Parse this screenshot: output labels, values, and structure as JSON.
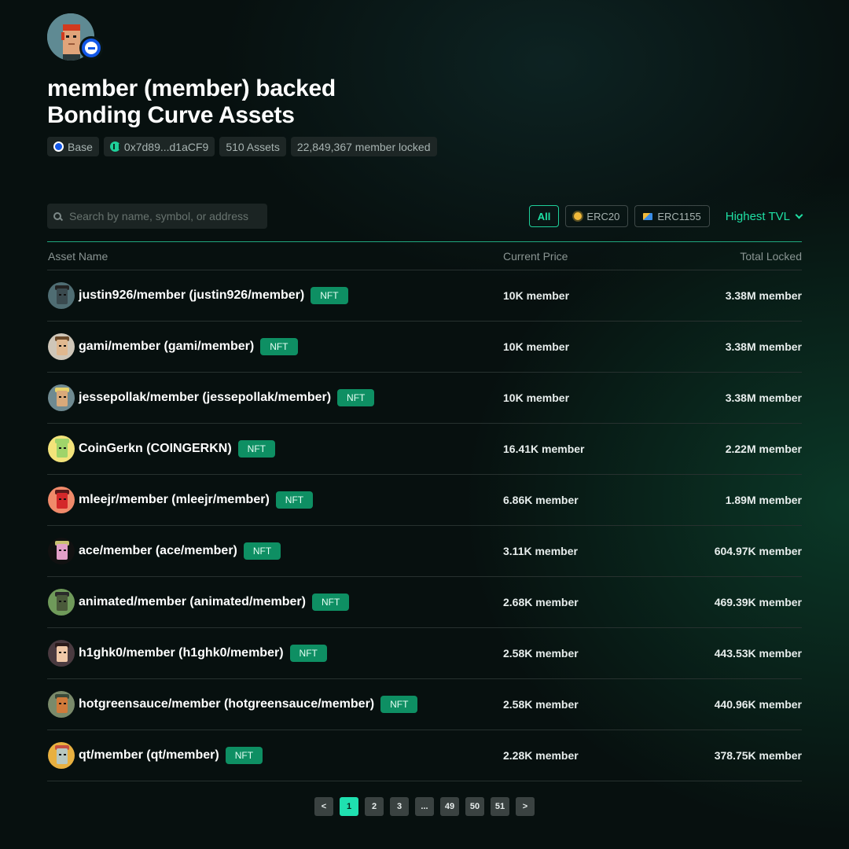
{
  "header": {
    "title_line1": "member (member) backed",
    "title_line2": "Bonding Curve Assets",
    "chain": "Base",
    "address": "0x7d89...d1aCF9",
    "assets_count": "510 Assets",
    "locked": "22,849,367 member locked"
  },
  "search": {
    "placeholder": "Search by name, symbol, or address"
  },
  "filters": {
    "all": "All",
    "erc20": "ERC20",
    "erc1155": "ERC1155",
    "sort": "Highest TVL"
  },
  "table": {
    "headers": {
      "name": "Asset Name",
      "price": "Current Price",
      "locked": "Total Locked"
    },
    "rows": [
      {
        "name": "justin926/member (justin926/member)",
        "badge": "NFT",
        "price": "10K member",
        "locked": "3.38M member",
        "bg": "#4f6d73",
        "skin": "#3a4a4f",
        "hat": "#222"
      },
      {
        "name": "gami/member (gami/member)",
        "badge": "NFT",
        "price": "10K member",
        "locked": "3.38M member",
        "bg": "#cfc6b8",
        "skin": "#e0b88f",
        "hat": "#6b4a2a"
      },
      {
        "name": "jessepollak/member (jessepollak/member)",
        "badge": "NFT",
        "price": "10K member",
        "locked": "3.38M member",
        "bg": "#6f8a91",
        "skin": "#d9a97a",
        "hat": "#e8d36a"
      },
      {
        "name": "CoinGerkn (COINGERKN)",
        "badge": "NFT",
        "price": "16.41K member",
        "locked": "2.22M member",
        "bg": "#f2e37a",
        "skin": "#9fd46a",
        "hat": "#9fd46a"
      },
      {
        "name": "mleejr/member (mleejr/member)",
        "badge": "NFT",
        "price": "6.86K member",
        "locked": "1.89M member",
        "bg": "#f08a6a",
        "skin": "#d4282a",
        "hat": "#5a1a1a"
      },
      {
        "name": "ace/member (ace/member)",
        "badge": "NFT",
        "price": "3.11K member",
        "locked": "604.97K member",
        "bg": "#111111",
        "skin": "#e2a0c8",
        "hat": "#c8c070"
      },
      {
        "name": "animated/member (animated/member)",
        "badge": "NFT",
        "price": "2.68K member",
        "locked": "469.39K member",
        "bg": "#6f9a5a",
        "skin": "#4a5a3a",
        "hat": "#2a2a2a"
      },
      {
        "name": "h1ghk0/member (h1ghk0/member)",
        "badge": "NFT",
        "price": "2.58K member",
        "locked": "443.53K member",
        "bg": "#4a3a40",
        "skin": "#f0c8a8",
        "hat": "#2a1a1a"
      },
      {
        "name": "hotgreensauce/member (hotgreensauce/member)",
        "badge": "NFT",
        "price": "2.58K member",
        "locked": "440.96K member",
        "bg": "#7a8a6a",
        "skin": "#d07a3a",
        "hat": "#3a4a3a"
      },
      {
        "name": "qt/member (qt/member)",
        "badge": "NFT",
        "price": "2.28K member",
        "locked": "378.75K member",
        "bg": "#e8b040",
        "skin": "#b8c8c0",
        "hat": "#c85040"
      }
    ]
  },
  "pagination": {
    "prev": "<",
    "pages": [
      "1",
      "2",
      "3",
      "...",
      "49",
      "50",
      "51"
    ],
    "current": "1",
    "next": ">"
  }
}
